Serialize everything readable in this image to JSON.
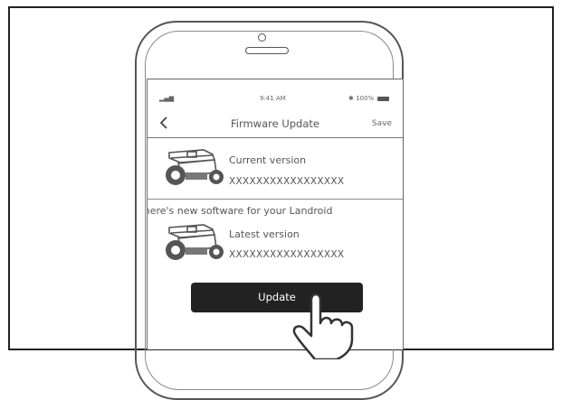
{
  "status_bar": {
    "signal": "▂▄▆",
    "time": "9:41 AM",
    "battery": "✱ 100%"
  },
  "nav": {
    "title": "Firmware Update",
    "save_label": "Save",
    "back_icon": "chevron-left-icon"
  },
  "current": {
    "label": "Current version",
    "value": "XXXXXXXXXXXXXXXXX"
  },
  "notice": "There's new software for your Landroid",
  "latest": {
    "label": "Latest version",
    "value": "XXXXXXXXXXXXXXXXX"
  },
  "update_button": {
    "label": "Update"
  },
  "colors": {
    "button": "#222222",
    "text": "#555555"
  }
}
